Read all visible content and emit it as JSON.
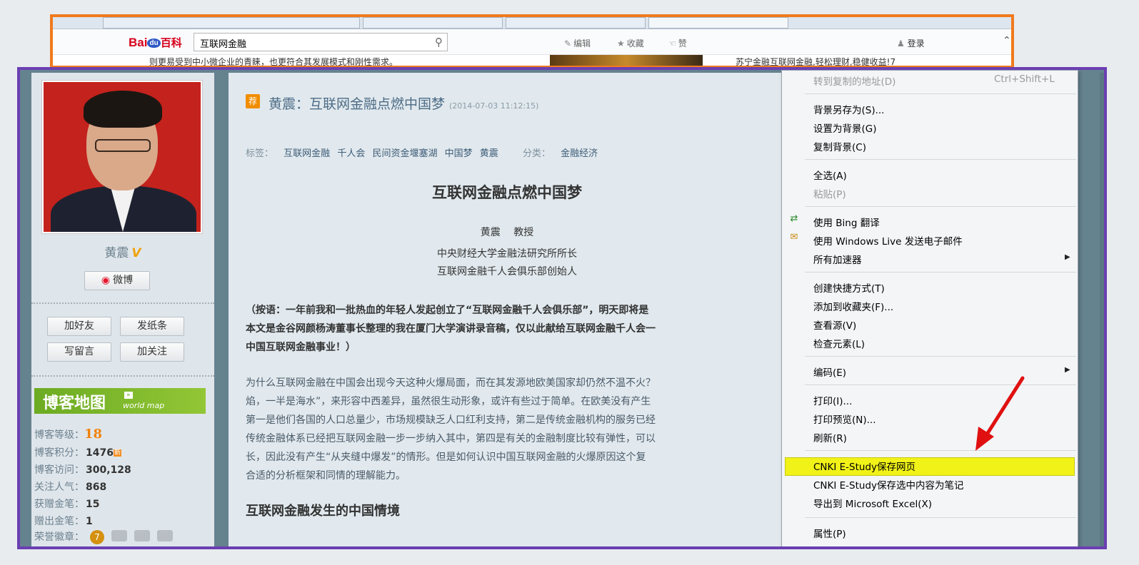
{
  "background_browser": {
    "search_value": "互联网金融",
    "actions": [
      "编辑",
      "收藏",
      "赞"
    ],
    "login_label": "登录",
    "strip_left_text": "则更易受到中小微企业的青睐，也更符合其发展模式和刚性需求。",
    "strip_right_text": "苏宁金融互联网金融,轻松理财,稳健收益!7"
  },
  "profile": {
    "name": "黄震",
    "weibo_label": "微博",
    "buttons": [
      "加好友",
      "发纸条",
      "写留言",
      "加关注"
    ],
    "map_banner": {
      "title": "博客地图",
      "subtitle": "world map"
    },
    "stats": [
      {
        "label": "博客等级：",
        "value": "18"
      },
      {
        "label": "博客积分：",
        "value": "1476"
      },
      {
        "label": "博客访问：",
        "value": "300,128"
      },
      {
        "label": "关注人气：",
        "value": "868"
      },
      {
        "label": "获赠金笔：",
        "value": "15"
      },
      {
        "label": "赠出金笔：",
        "value": "1"
      }
    ],
    "honor_label": "荣誉徽章：",
    "honor_medal": "7"
  },
  "article": {
    "badge": "荐",
    "title": "黄震：互联网金融点燃中国梦",
    "date": "(2014-07-03 11:12:15)",
    "tags_label": "标签：",
    "tags": [
      "互联网金融",
      "千人会",
      "民间资金堰塞湖",
      "中国梦",
      "黄震"
    ],
    "category_label": "分类：",
    "category": "金融经济",
    "main_title": "互联网金融点燃中国梦",
    "author": "黄震　 教授",
    "affiliation1": "中央财经大学金融法研究所所长",
    "affiliation2": "互联网金融千人会俱乐部创始人",
    "bold_lines": [
      "（按语：一年前我和一批热血的年轻人发起创立了“互联网金融千人会俱乐部”，明天即将是",
      "本文是金谷网颜杨涛董事长整理的我在厦门大学演讲录音稿，仅以此献给互联网金融千人会一",
      "中国互联网金融事业！）"
    ],
    "body_lines": [
      "为什么互联网金融在中国会出现今天这种火爆局面，而在其发源地欧美国家却仍然不温不火？",
      "焰，一半是海水”，来形容中西差异，虽然很生动形象，或许有些过于简单。在欧美没有产生",
      "第一是他们各国的人口总量少，市场规模缺乏人口红利支持，第二是传统金融机构的服务已经",
      "传统金融体系已经把互联网金融一步一步纳入其中，第四是有关的金融制度比较有弹性，可以",
      "长，因此没有产生“从夹缝中爆发”的情形。但是如何认识中国互联网金融的火爆原因这个复",
      "合适的分析框架和同情的理解能力。"
    ],
    "subheading": "互联网金融发生的中国情境"
  },
  "context_menu": {
    "items": [
      {
        "label": "转到复制的地址(D)",
        "shortcut": "Ctrl+Shift+L",
        "disabled": true
      },
      {
        "label": "背景另存为(S)..."
      },
      {
        "label": "设置为背景(G)"
      },
      {
        "label": "复制背景(C)"
      },
      {
        "label": "全选(A)"
      },
      {
        "label": "粘贴(P)",
        "disabled": true
      },
      {
        "label": "使用 Bing 翻译",
        "icon": "translate-icon"
      },
      {
        "label": "使用 Windows Live 发送电子邮件",
        "icon": "email-icon"
      },
      {
        "label": "所有加速器",
        "submenu": true
      },
      {
        "label": "创建快捷方式(T)"
      },
      {
        "label": "添加到收藏夹(F)..."
      },
      {
        "label": "查看源(V)"
      },
      {
        "label": "检查元素(L)"
      },
      {
        "label": "编码(E)",
        "submenu": true
      },
      {
        "label": "打印(I)..."
      },
      {
        "label": "打印预览(N)..."
      },
      {
        "label": "刷新(R)"
      },
      {
        "label": "CNKI E-Study保存网页",
        "highlighted": true
      },
      {
        "label": "CNKI E-Study保存选中内容为笔记"
      },
      {
        "label": "导出到 Microsoft Excel(X)"
      },
      {
        "label": "属性(P)"
      }
    ]
  },
  "colors": {
    "orange_frame": "#f07a1e",
    "purple_frame": "#6b3fb2",
    "highlight": "#f1f218",
    "arrow": "#e01010"
  }
}
